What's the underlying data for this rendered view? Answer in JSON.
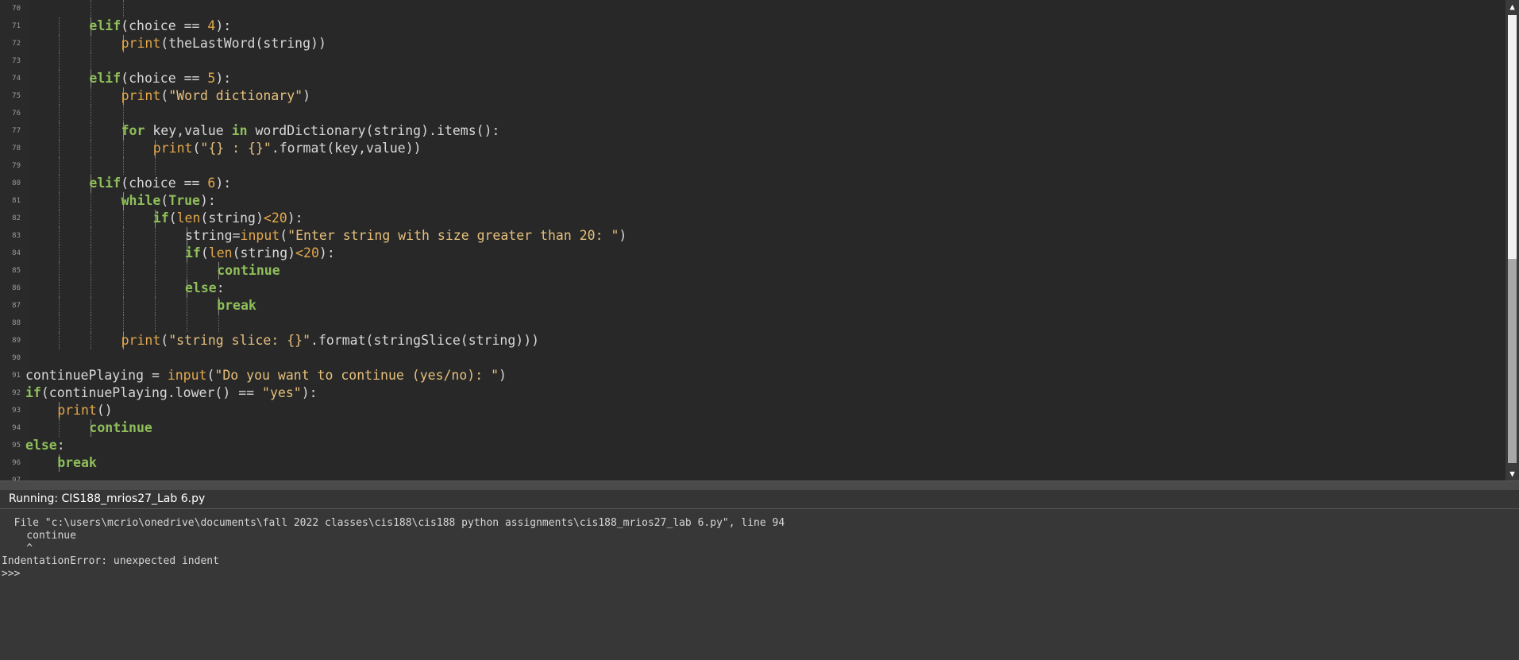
{
  "editor": {
    "lines": [
      {
        "n": "70",
        "indent": 0,
        "guides": [
          2,
          3
        ],
        "tokens": []
      },
      {
        "n": "71",
        "indent": 2,
        "guides": [
          1,
          2
        ],
        "tokens": [
          [
            "kw",
            "elif"
          ],
          [
            "op",
            "(choice == "
          ],
          [
            "num",
            "4"
          ],
          [
            "op",
            "):"
          ]
        ]
      },
      {
        "n": "72",
        "indent": 3,
        "guides": [
          1,
          2,
          3
        ],
        "tokens": [
          [
            "bi",
            "print"
          ],
          [
            "op",
            "(theLastWord(string))"
          ]
        ]
      },
      {
        "n": "73",
        "indent": 0,
        "guides": [
          1,
          2
        ],
        "tokens": []
      },
      {
        "n": "74",
        "indent": 2,
        "guides": [
          1,
          2
        ],
        "tokens": [
          [
            "kw",
            "elif"
          ],
          [
            "op",
            "(choice == "
          ],
          [
            "num",
            "5"
          ],
          [
            "op",
            "):"
          ]
        ]
      },
      {
        "n": "75",
        "indent": 3,
        "guides": [
          1,
          2,
          3
        ],
        "tokens": [
          [
            "bi",
            "print"
          ],
          [
            "op",
            "("
          ],
          [
            "str",
            "\"Word dictionary\""
          ],
          [
            "op",
            ")"
          ]
        ]
      },
      {
        "n": "76",
        "indent": 0,
        "guides": [
          1,
          2,
          3
        ],
        "tokens": []
      },
      {
        "n": "77",
        "indent": 3,
        "guides": [
          1,
          2,
          3
        ],
        "tokens": [
          [
            "kw",
            "for"
          ],
          [
            "op",
            " key,value "
          ],
          [
            "kw",
            "in"
          ],
          [
            "op",
            " wordDictionary(string).items():"
          ]
        ]
      },
      {
        "n": "78",
        "indent": 4,
        "guides": [
          1,
          2,
          3,
          4
        ],
        "tokens": [
          [
            "bi",
            "print"
          ],
          [
            "op",
            "("
          ],
          [
            "str",
            "\"{} : {}\""
          ],
          [
            "op",
            ".format(key,value))"
          ]
        ]
      },
      {
        "n": "79",
        "indent": 0,
        "guides": [
          1,
          2,
          3,
          4
        ],
        "tokens": []
      },
      {
        "n": "80",
        "indent": 2,
        "guides": [
          1,
          2
        ],
        "tokens": [
          [
            "kw",
            "elif"
          ],
          [
            "op",
            "(choice == "
          ],
          [
            "num",
            "6"
          ],
          [
            "op",
            "):"
          ]
        ]
      },
      {
        "n": "81",
        "indent": 3,
        "guides": [
          1,
          2,
          3
        ],
        "tokens": [
          [
            "kw",
            "while"
          ],
          [
            "op",
            "("
          ],
          [
            "kw",
            "True"
          ],
          [
            "op",
            "):"
          ]
        ]
      },
      {
        "n": "82",
        "indent": 4,
        "guides": [
          1,
          2,
          3,
          4
        ],
        "tokens": [
          [
            "kw",
            "if"
          ],
          [
            "op",
            "("
          ],
          [
            "bi",
            "len"
          ],
          [
            "op",
            "(string)"
          ],
          [
            "num",
            "<20"
          ],
          [
            "op",
            "):"
          ]
        ]
      },
      {
        "n": "83",
        "indent": 5,
        "guides": [
          1,
          2,
          3,
          4,
          5
        ],
        "tokens": [
          [
            "op",
            "string="
          ],
          [
            "bi",
            "input"
          ],
          [
            "op",
            "("
          ],
          [
            "str",
            "\"Enter string with size greater than 20: \""
          ],
          [
            "op",
            ")"
          ]
        ]
      },
      {
        "n": "84",
        "indent": 5,
        "guides": [
          1,
          2,
          3,
          4,
          5
        ],
        "tokens": [
          [
            "kw",
            "if"
          ],
          [
            "op",
            "("
          ],
          [
            "bi",
            "len"
          ],
          [
            "op",
            "(string)"
          ],
          [
            "num",
            "<20"
          ],
          [
            "op",
            "):"
          ]
        ]
      },
      {
        "n": "85",
        "indent": 6,
        "guides": [
          1,
          2,
          3,
          4,
          5,
          6
        ],
        "tokens": [
          [
            "kw",
            "continue"
          ]
        ]
      },
      {
        "n": "86",
        "indent": 5,
        "guides": [
          1,
          2,
          3,
          4,
          5
        ],
        "tokens": [
          [
            "kw",
            "else"
          ],
          [
            "op",
            ":"
          ]
        ]
      },
      {
        "n": "87",
        "indent": 6,
        "guides": [
          1,
          2,
          3,
          4,
          5,
          6
        ],
        "tokens": [
          [
            "kw",
            "break"
          ]
        ]
      },
      {
        "n": "88",
        "indent": 0,
        "guides": [
          1,
          2,
          3,
          4,
          5,
          6
        ],
        "tokens": []
      },
      {
        "n": "89",
        "indent": 3,
        "guides": [
          1,
          2,
          3
        ],
        "tokens": [
          [
            "bi",
            "print"
          ],
          [
            "op",
            "("
          ],
          [
            "str",
            "\"string slice: {}\""
          ],
          [
            "op",
            ".format(stringSlice(string)))"
          ]
        ]
      },
      {
        "n": "90",
        "indent": 0,
        "guides": [],
        "tokens": []
      },
      {
        "n": "91",
        "indent": 0,
        "guides": [],
        "tokens": [
          [
            "op",
            "continuePlaying = "
          ],
          [
            "bi",
            "input"
          ],
          [
            "op",
            "("
          ],
          [
            "str",
            "\"Do you want to continue (yes/no): \""
          ],
          [
            "op",
            ")"
          ]
        ]
      },
      {
        "n": "92",
        "indent": 0,
        "guides": [],
        "tokens": [
          [
            "kw",
            "if"
          ],
          [
            "op",
            "(continuePlaying.lower() == "
          ],
          [
            "str",
            "\"yes\""
          ],
          [
            "op",
            "):"
          ]
        ]
      },
      {
        "n": "93",
        "indent": 1,
        "guides": [
          1
        ],
        "tokens": [
          [
            "bi",
            "print"
          ],
          [
            "op",
            "()"
          ]
        ]
      },
      {
        "n": "94",
        "indent": 2,
        "guides": [
          1,
          2
        ],
        "tokens": [
          [
            "kw",
            "continue"
          ]
        ]
      },
      {
        "n": "95",
        "indent": 0,
        "guides": [],
        "tokens": [
          [
            "kw",
            "else"
          ],
          [
            "op",
            ":"
          ]
        ]
      },
      {
        "n": "96",
        "indent": 1,
        "guides": [
          1
        ],
        "tokens": [
          [
            "kw",
            "break"
          ]
        ]
      },
      {
        "n": "97",
        "indent": 0,
        "guides": [],
        "tokens": []
      }
    ]
  },
  "scrollbar": {
    "up_icon": "▲",
    "down_icon": "▼",
    "thumb_start_fraction": 0.545,
    "thumb_size_fraction": 0.455
  },
  "panel": {
    "title": "Running: CIS188_mrios27_Lab 6.py"
  },
  "console": {
    "lines": [
      "  File \"c:\\users\\mcrio\\onedrive\\documents\\fall 2022 classes\\cis188\\cis188 python assignments\\cis188_mrios27_lab 6.py\", line 94",
      "    continue",
      "    ^",
      "IndentationError: unexpected indent",
      ">>> "
    ]
  }
}
